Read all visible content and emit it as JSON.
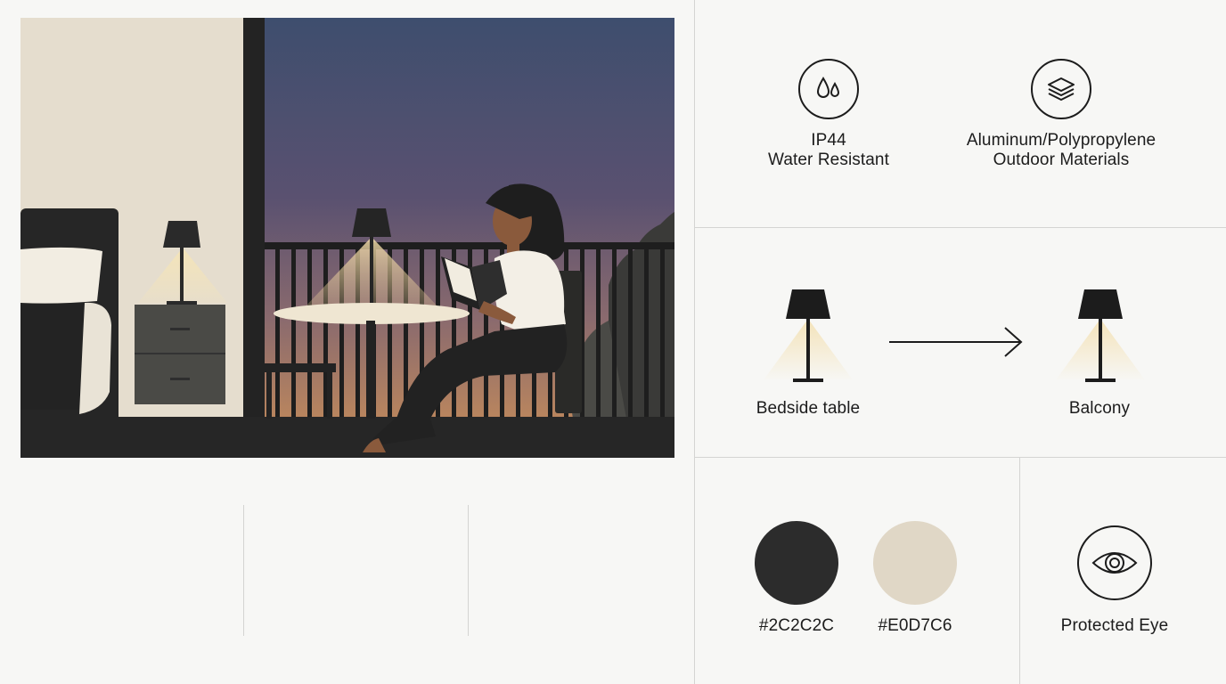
{
  "features": {
    "water": {
      "rating": "IP44",
      "label": "Water Resistant",
      "icon": "water-drops-icon"
    },
    "materials": {
      "line1": "Aluminum/Polypropylene",
      "line2": "Outdoor Materials",
      "icon": "layers-icon"
    }
  },
  "usage": {
    "from_label": "Bedside table",
    "to_label": "Balcony",
    "icon": "table-lamp-icon",
    "connector": "arrow-right-icon"
  },
  "colors": {
    "swatches": [
      {
        "hex": "#2C2C2C",
        "label": "#2C2C2C"
      },
      {
        "hex": "#E0D7C6",
        "label": "#E0D7C6"
      }
    ]
  },
  "eye": {
    "label": "Protected Eye",
    "icon": "eye-icon"
  },
  "palette": {
    "background": "#f7f7f5",
    "divider": "#d4d4d2",
    "ink": "#1c1c1c"
  }
}
